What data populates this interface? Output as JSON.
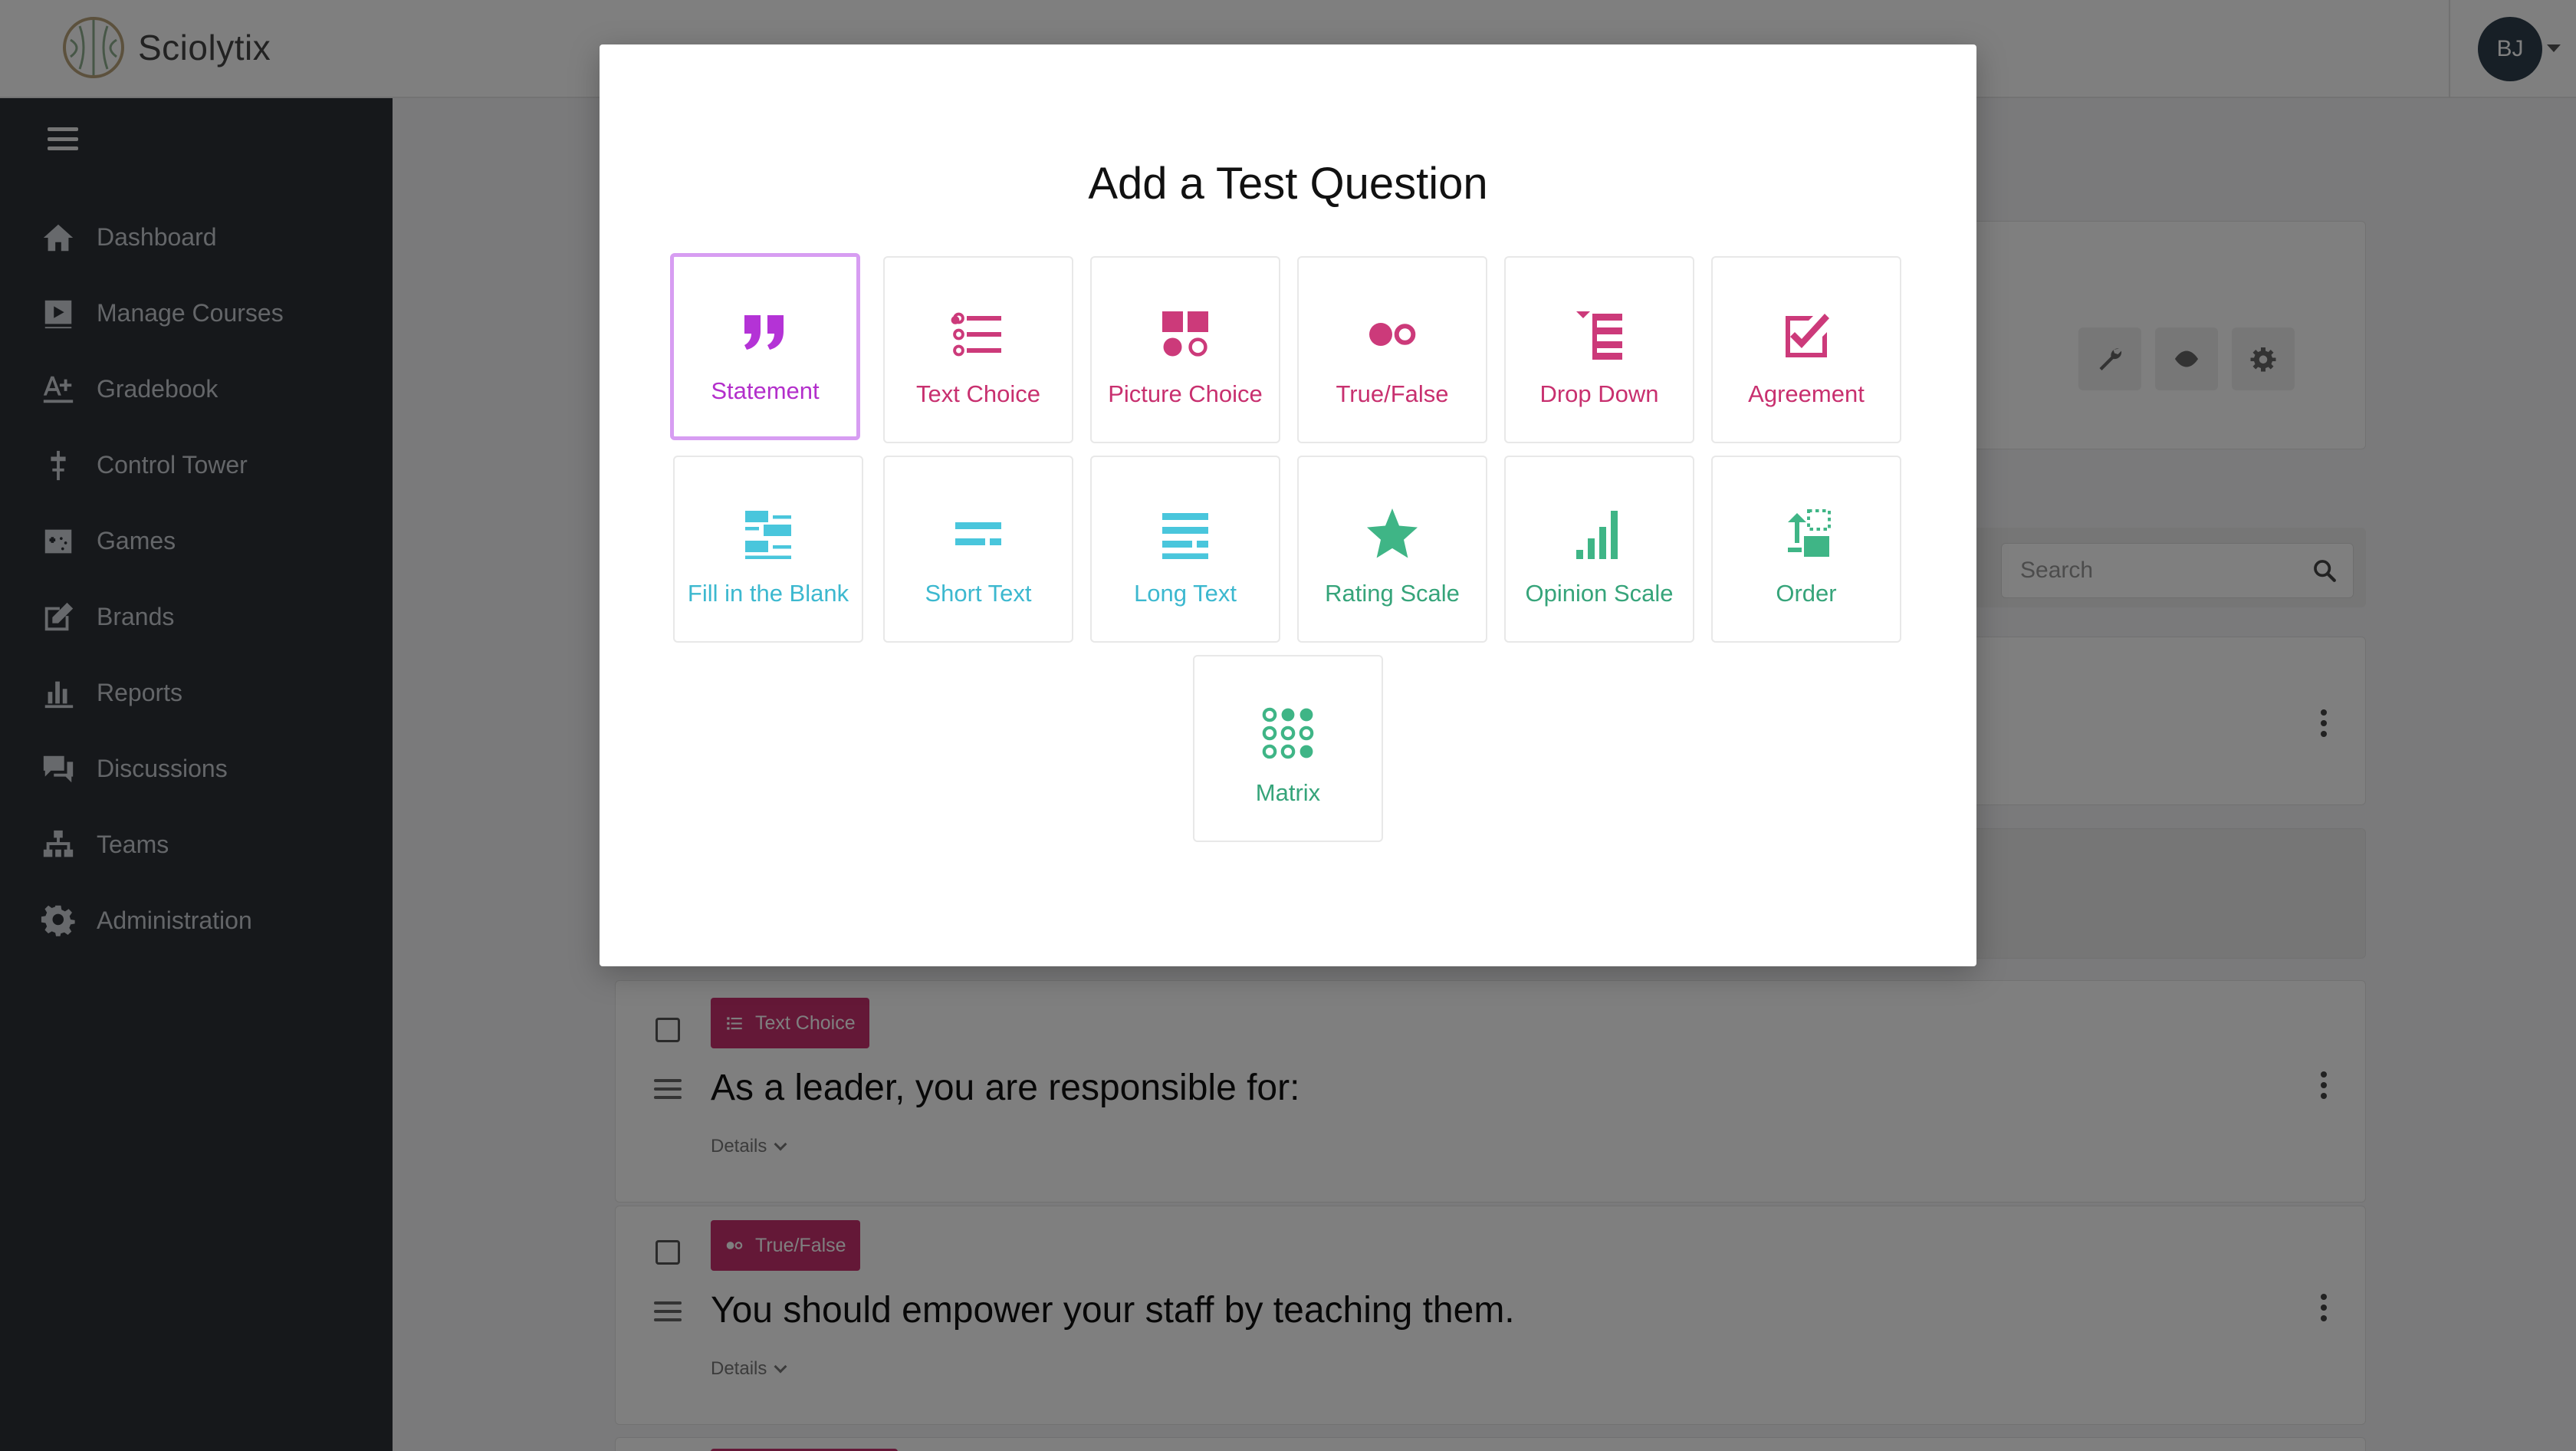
{
  "app": {
    "brand_name": "Sciolytix",
    "user_initials": "BJ"
  },
  "sidebar": {
    "items": [
      {
        "label": "Dashboard",
        "icon": "home-icon"
      },
      {
        "label": "Manage Courses",
        "icon": "play-course-icon"
      },
      {
        "label": "Gradebook",
        "icon": "grade-a-plus-icon"
      },
      {
        "label": "Control Tower",
        "icon": "tower-icon"
      },
      {
        "label": "Games",
        "icon": "gamepad-icon"
      },
      {
        "label": "Brands",
        "icon": "edit-square-icon"
      },
      {
        "label": "Reports",
        "icon": "bar-chart-icon"
      },
      {
        "label": "Discussions",
        "icon": "comments-icon"
      },
      {
        "label": "Teams",
        "icon": "org-chart-icon"
      },
      {
        "label": "Administration",
        "icon": "gear-icon"
      }
    ]
  },
  "main": {
    "search_placeholder": "Search",
    "questions": [
      {
        "type_label": "Text Choice",
        "title": "As a leader, you are responsible for:",
        "details_label": "Details"
      },
      {
        "type_label": "True/False",
        "title": "You should empower your staff by teaching them.",
        "details_label": "Details"
      }
    ]
  },
  "modal": {
    "title": "Add a Test Question",
    "question_types": [
      {
        "label": "Statement",
        "icon": "quote-icon",
        "color": "#b433d6",
        "selected": true
      },
      {
        "label": "Text Choice",
        "icon": "list-icon",
        "color": "#cc3a7a"
      },
      {
        "label": "Picture Choice",
        "icon": "picture-choice-icon",
        "color": "#cc3a7a"
      },
      {
        "label": "True/False",
        "icon": "toggle-dots-icon",
        "color": "#cc3a7a"
      },
      {
        "label": "Drop Down",
        "icon": "dropdown-list-icon",
        "color": "#cc3a7a"
      },
      {
        "label": "Agreement",
        "icon": "checkbox-check-icon",
        "color": "#cc3a7a"
      },
      {
        "label": "Fill in the Blank",
        "icon": "fill-blank-icon",
        "color": "#49c6dc"
      },
      {
        "label": "Short Text",
        "icon": "short-text-icon",
        "color": "#49c6dc"
      },
      {
        "label": "Long Text",
        "icon": "long-text-icon",
        "color": "#49c6dc"
      },
      {
        "label": "Rating Scale",
        "icon": "star-icon",
        "color": "#3fb586"
      },
      {
        "label": "Opinion Scale",
        "icon": "signal-bars-icon",
        "color": "#3fb586"
      },
      {
        "label": "Order",
        "icon": "order-icon",
        "color": "#3fb586"
      },
      {
        "label": "Matrix",
        "icon": "matrix-dots-icon",
        "color": "#3fb586"
      }
    ]
  }
}
